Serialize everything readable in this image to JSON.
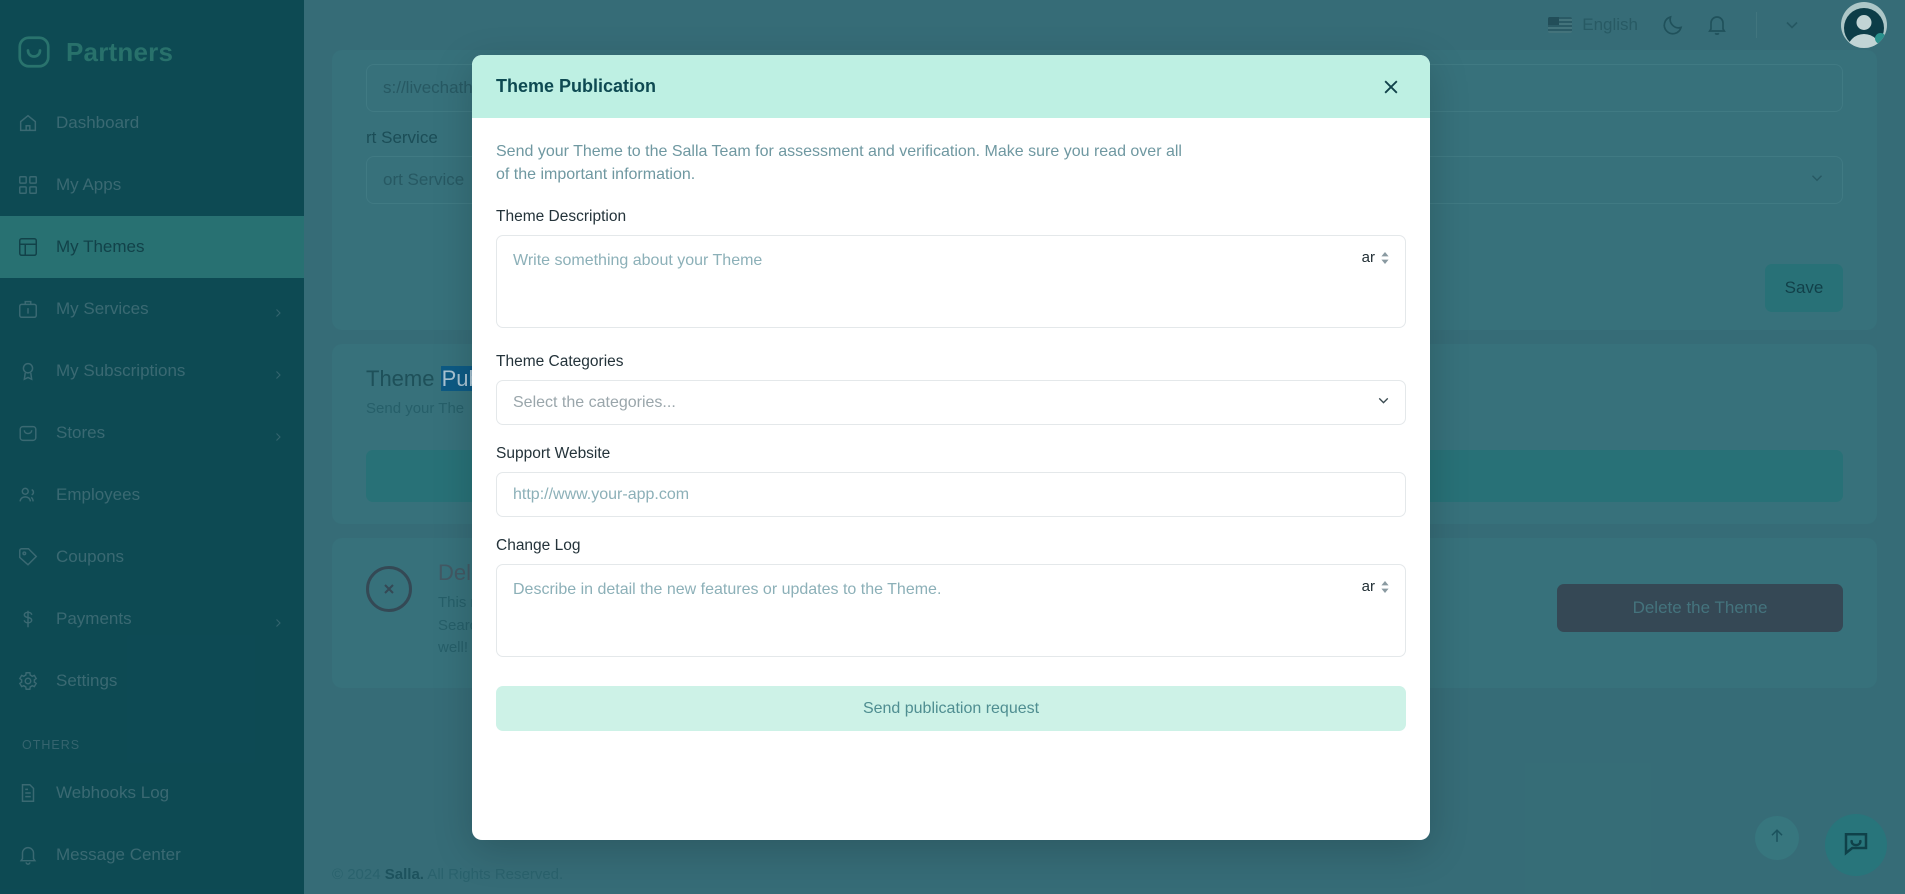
{
  "sidebar": {
    "brand": "Partners",
    "logo_icon": "salla-bag-smile-icon",
    "items": [
      {
        "label": "Dashboard",
        "icon": "home-icon",
        "has_chevron": false,
        "active": false
      },
      {
        "label": "My Apps",
        "icon": "grid-icon",
        "has_chevron": false,
        "active": false
      },
      {
        "label": "My Themes",
        "icon": "layout-icon",
        "has_chevron": false,
        "active": true
      },
      {
        "label": "My Services",
        "icon": "briefcase-icon",
        "has_chevron": true,
        "active": false
      },
      {
        "label": "My Subscriptions",
        "icon": "award-icon",
        "has_chevron": true,
        "active": false
      },
      {
        "label": "Stores",
        "icon": "bag-icon",
        "has_chevron": true,
        "active": false
      },
      {
        "label": "Employees",
        "icon": "users-icon",
        "has_chevron": false,
        "active": false
      },
      {
        "label": "Coupons",
        "icon": "tag-icon",
        "has_chevron": false,
        "active": false
      },
      {
        "label": "Payments",
        "icon": "dollar-icon",
        "has_chevron": true,
        "active": false
      },
      {
        "label": "Settings",
        "icon": "gear-icon",
        "has_chevron": false,
        "active": false
      }
    ],
    "others_title": "OTHERS",
    "others_items": [
      {
        "label": "Webhooks Log",
        "icon": "document-icon",
        "has_chevron": false
      },
      {
        "label": "Message Center",
        "icon": "bell-icon",
        "has_chevron": false
      }
    ]
  },
  "header": {
    "language": "English",
    "flag_icon": "us-flag-icon",
    "dark_mode_icon": "moon-icon",
    "notifications_icon": "bell-icon",
    "caret_icon": "chevron-down-icon",
    "avatar_icon": "avatar"
  },
  "background": {
    "support_url_value": "s://livechathere.com",
    "support_service_label": "rt Service",
    "support_service_value": "ort Service",
    "save_label": "Save",
    "publication_title_plain": "Theme ",
    "publication_title_selected": "Pub",
    "publication_desc": "Send your The",
    "delete_title": "Dele",
    "delete_line1": "This r",
    "delete_line2": "Searc",
    "delete_line3": "well!",
    "delete_button": "Delete the Theme",
    "danger_icon": "circle-x-icon",
    "scroll_top_icon": "arrow-up-icon",
    "chat_icon": "chat-bubble-icon"
  },
  "footer": {
    "copyright_pre": "© 2024 ",
    "brand": "Salla.",
    "copyright_post": " All Rights Reserved."
  },
  "modal": {
    "title": "Theme Publication",
    "close_icon": "close-icon",
    "intro": "Send your Theme to the Salla Team for assessment and verification. Make sure you read over all of the important information.",
    "fields": {
      "description": {
        "label": "Theme Description",
        "placeholder": "Write something about your Theme",
        "value": "",
        "lang": "ar",
        "lang_spinner_icon": "sort-updown-icon"
      },
      "categories": {
        "label": "Theme Categories",
        "placeholder": "Select the categories...",
        "value": "",
        "caret_icon": "chevron-down-icon"
      },
      "support_website": {
        "label": "Support Website",
        "placeholder": "http://www.your-app.com",
        "value": ""
      },
      "change_log": {
        "label": "Change Log",
        "placeholder": "Describe in detail the new features or updates to the Theme.",
        "value": "",
        "lang": "ar",
        "lang_spinner_icon": "sort-updown-icon"
      }
    },
    "submit_label": "Send publication request"
  },
  "colors": {
    "sidebar_bg": "#0c4b55",
    "page_bg": "#3d7580",
    "accent_mint": "#bef0e3",
    "accent_teal": "#2c7a7b",
    "submit_bg": "#cdf2e7",
    "danger_btn": "#3c4957"
  }
}
